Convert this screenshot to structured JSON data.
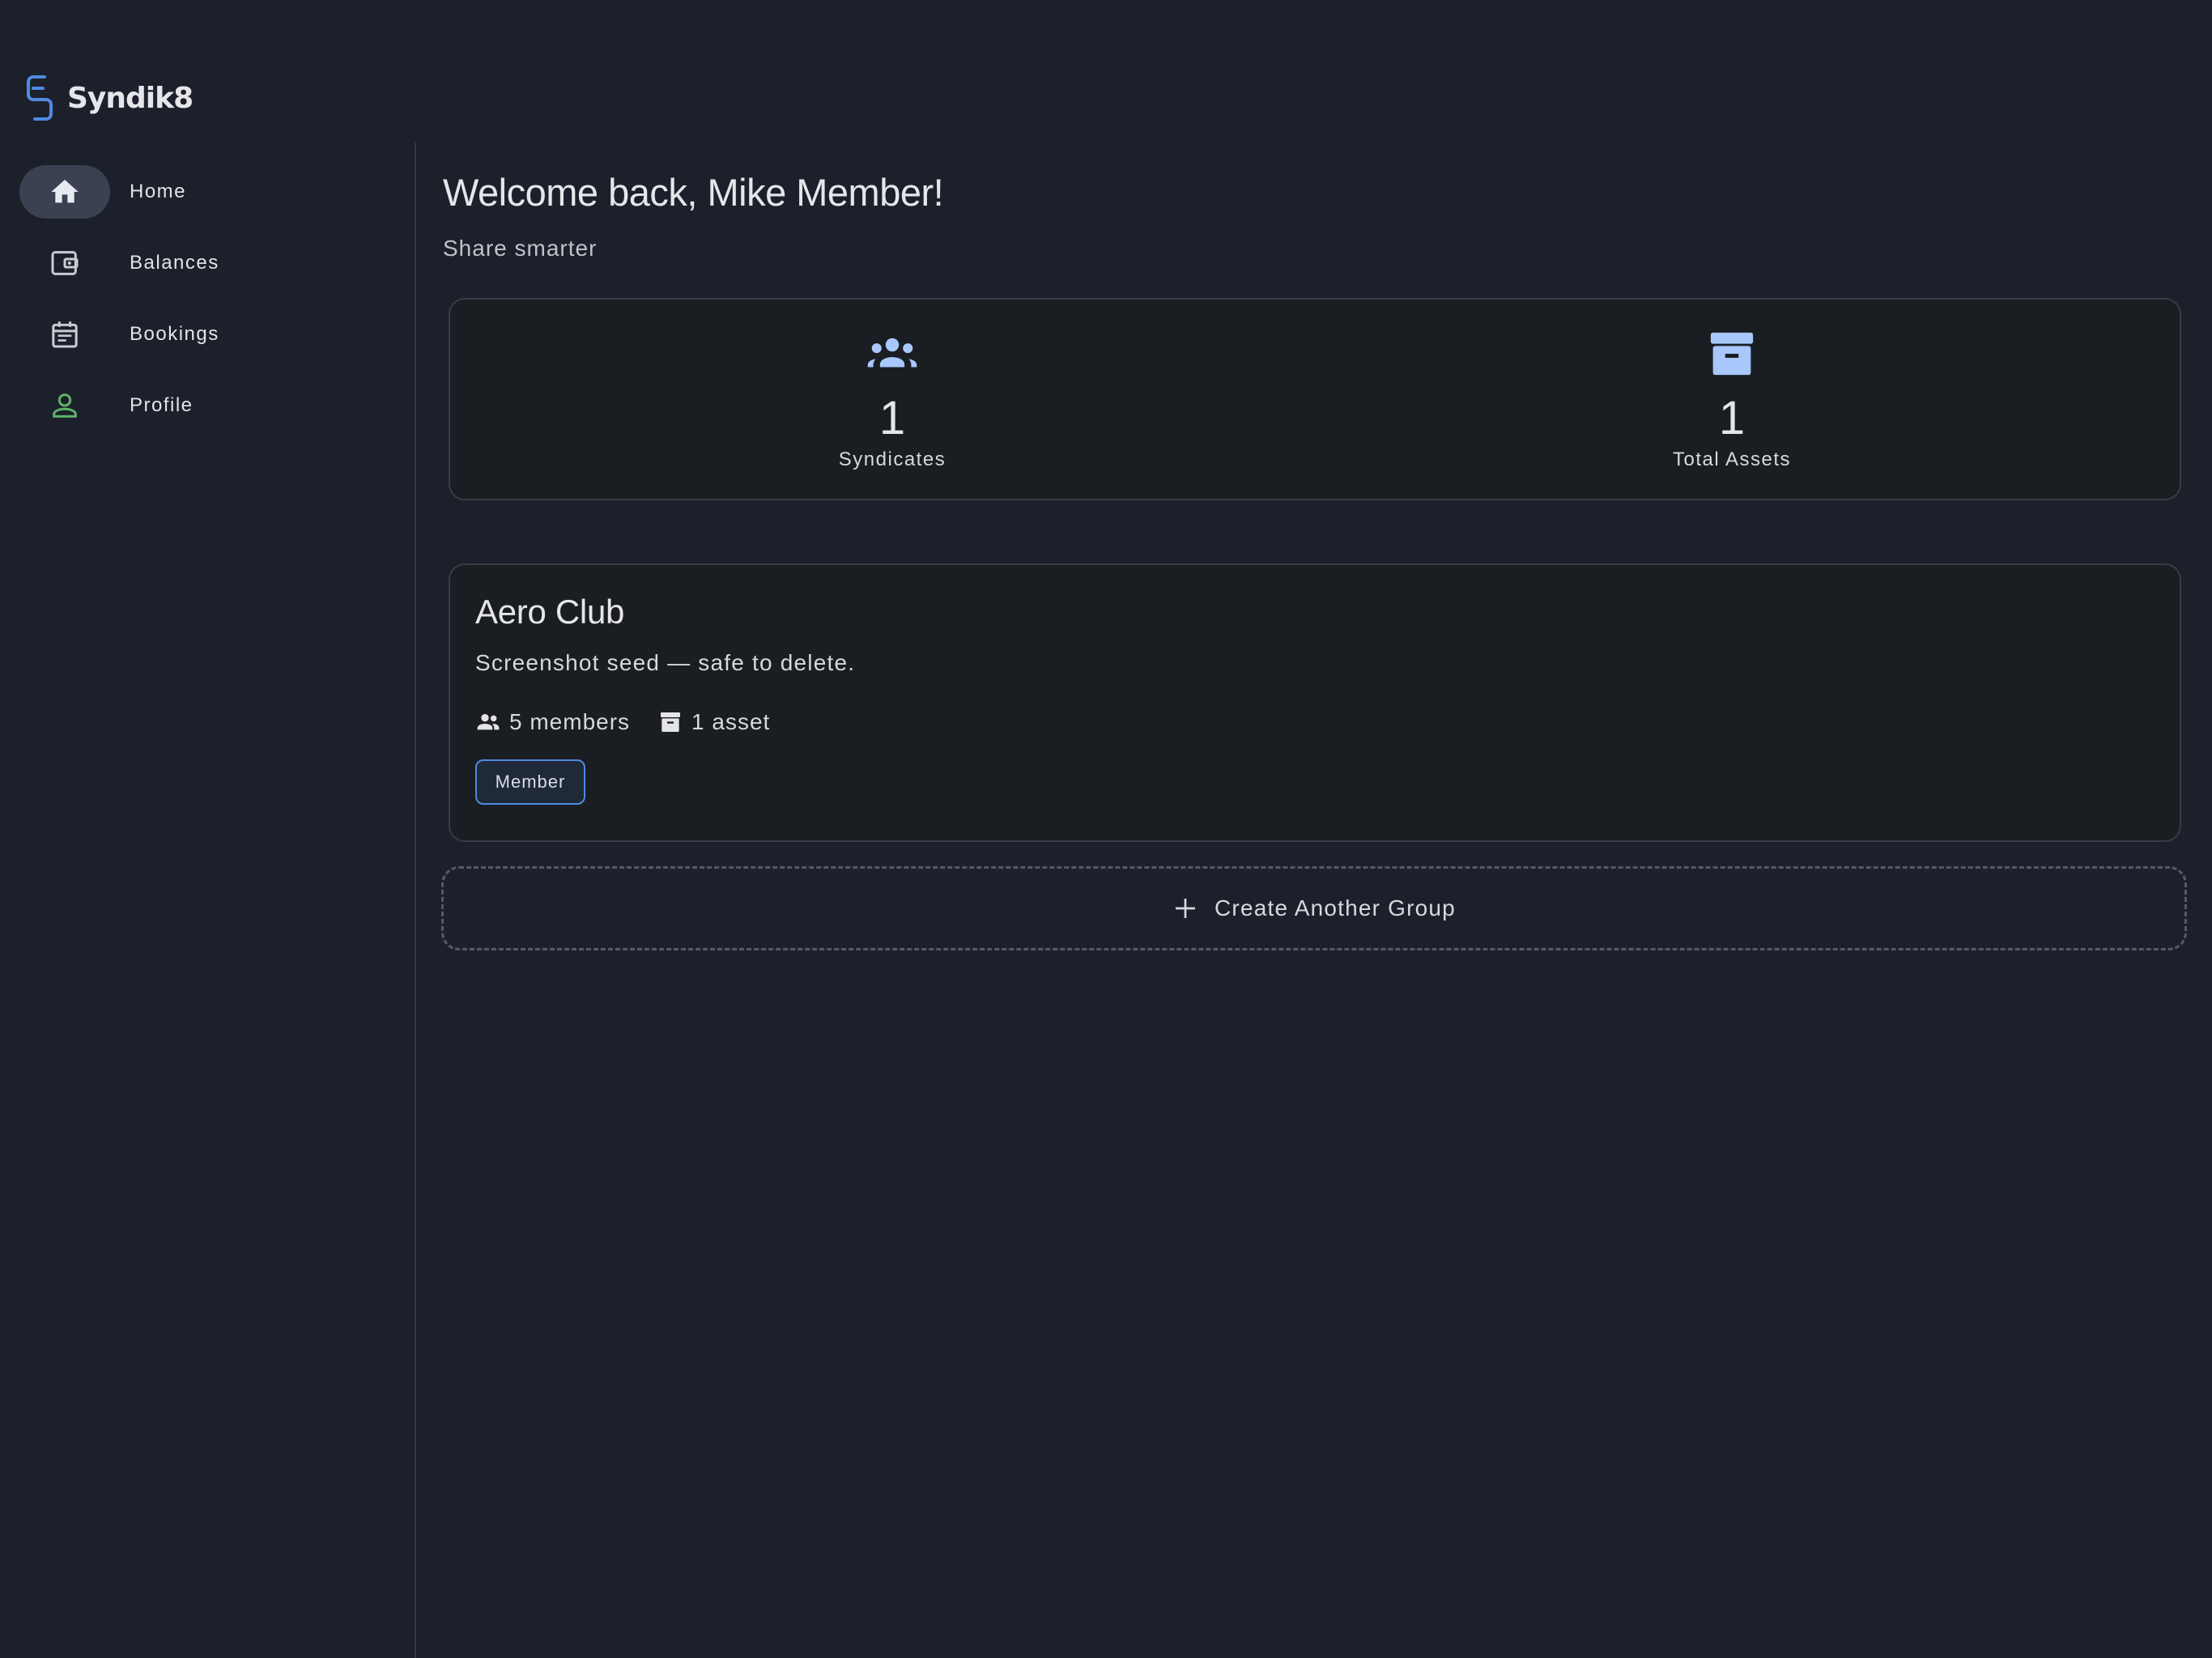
{
  "brand": {
    "name": "Syndik8",
    "logo_icon": "chain-link-logo-icon",
    "logo_color": "#4f8ae0"
  },
  "sidebar": {
    "items": [
      {
        "label": "Home",
        "icon": "home-icon",
        "active": true
      },
      {
        "label": "Balances",
        "icon": "wallet-icon",
        "active": false
      },
      {
        "label": "Bookings",
        "icon": "calendar-icon",
        "active": false
      },
      {
        "label": "Profile",
        "icon": "person-icon",
        "active": false
      }
    ]
  },
  "main": {
    "welcome": "Welcome back, Mike Member!",
    "tagline": "Share smarter",
    "stats": [
      {
        "value": "1",
        "label": "Syndicates",
        "icon": "groups-icon"
      },
      {
        "value": "1",
        "label": "Total Assets",
        "icon": "archive-box-icon"
      }
    ],
    "group": {
      "title": "Aero Club",
      "description": "Screenshot seed — safe to delete.",
      "members_text": "5 members",
      "assets_text": "1 asset",
      "role": "Member"
    },
    "create_label": "Create Another Group"
  },
  "colors": {
    "background": "#1c202b",
    "card_background": "#1a1d22",
    "accent": "#4f8ae0",
    "stat_icon": "#a8c7fa",
    "profile_icon": "#5fb36a",
    "active_nav": "#3a4150"
  }
}
